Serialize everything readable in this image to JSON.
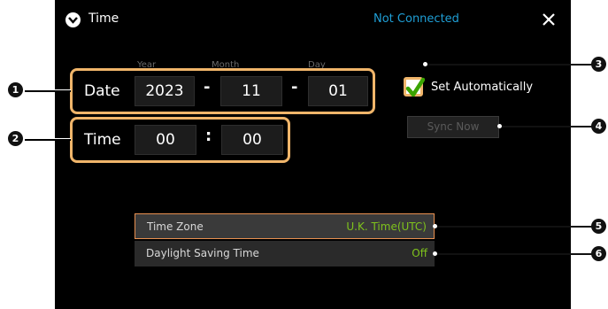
{
  "header": {
    "title": "Time",
    "status": "Not Connected"
  },
  "date": {
    "label": "Date",
    "year_header": "Year",
    "month_header": "Month",
    "day_header": "Day",
    "year": "2023",
    "month": "11",
    "day": "01",
    "separator": "-"
  },
  "time": {
    "label": "Time",
    "hour": "00",
    "minute": "00",
    "separator": ":"
  },
  "auto": {
    "label": "Set Automatically",
    "checked": true
  },
  "sync": {
    "label": "Sync Now"
  },
  "settings": {
    "time_zone_label": "Time Zone",
    "time_zone_value": "U.K. Time(UTC)",
    "dst_label": "Daylight Saving Time",
    "dst_value": "Off"
  },
  "callouts": [
    "1",
    "2",
    "3",
    "4",
    "5",
    "6"
  ],
  "colors": {
    "accent_orange": "#f0b56a",
    "status_blue": "#1f9fd6",
    "value_green": "#7fc31c"
  }
}
